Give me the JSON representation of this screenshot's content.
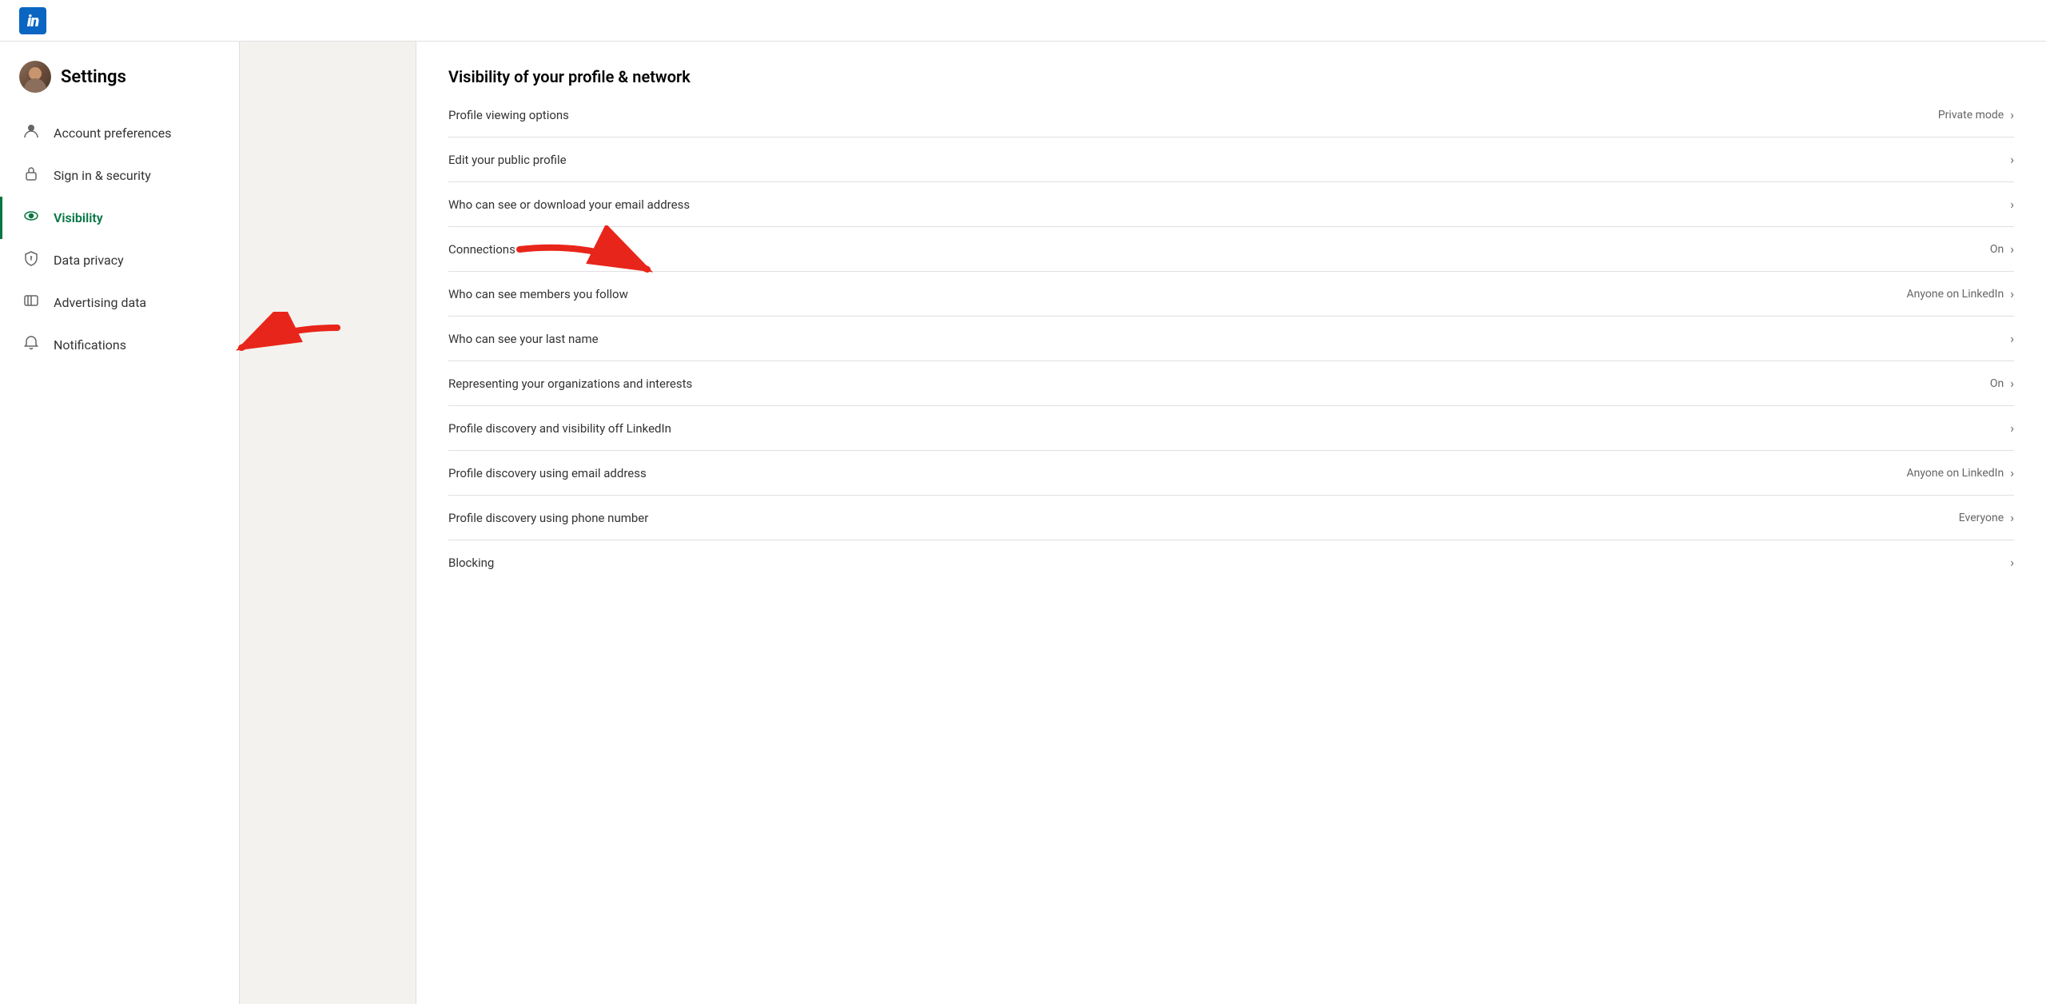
{
  "topNav": {
    "logo": "in"
  },
  "sidebar": {
    "title": "Settings",
    "items": [
      {
        "id": "account-preferences",
        "label": "Account preferences",
        "icon": "person",
        "active": false
      },
      {
        "id": "sign-in-security",
        "label": "Sign in & security",
        "icon": "lock",
        "active": false
      },
      {
        "id": "visibility",
        "label": "Visibility",
        "icon": "eye",
        "active": true
      },
      {
        "id": "data-privacy",
        "label": "Data privacy",
        "icon": "shield",
        "active": false
      },
      {
        "id": "advertising-data",
        "label": "Advertising data",
        "icon": "ad",
        "active": false
      },
      {
        "id": "notifications",
        "label": "Notifications",
        "icon": "bell",
        "active": false
      }
    ]
  },
  "mainContent": {
    "sectionTitle": "Visibility of your profile & network",
    "items": [
      {
        "id": "profile-viewing-options",
        "label": "Profile viewing options",
        "value": "Private mode",
        "hasChevron": true
      },
      {
        "id": "edit-public-profile",
        "label": "Edit your public profile",
        "value": "",
        "hasChevron": true
      },
      {
        "id": "email-visibility",
        "label": "Who can see or download your email address",
        "value": "",
        "hasChevron": true
      },
      {
        "id": "connections",
        "label": "Connections",
        "value": "On",
        "hasChevron": true
      },
      {
        "id": "members-follow",
        "label": "Who can see members you follow",
        "value": "Anyone on LinkedIn",
        "hasChevron": true
      },
      {
        "id": "last-name",
        "label": "Who can see your last name",
        "value": "",
        "hasChevron": true
      },
      {
        "id": "organizations",
        "label": "Representing your organizations and interests",
        "value": "On",
        "hasChevron": true
      },
      {
        "id": "profile-discovery-off",
        "label": "Profile discovery and visibility off LinkedIn",
        "value": "",
        "hasChevron": true
      },
      {
        "id": "profile-discovery-email",
        "label": "Profile discovery using email address",
        "value": "Anyone on LinkedIn",
        "hasChevron": true
      },
      {
        "id": "profile-discovery-phone",
        "label": "Profile discovery using phone number",
        "value": "Everyone",
        "hasChevron": true
      },
      {
        "id": "blocking",
        "label": "Blocking",
        "value": "",
        "hasChevron": true
      }
    ]
  }
}
